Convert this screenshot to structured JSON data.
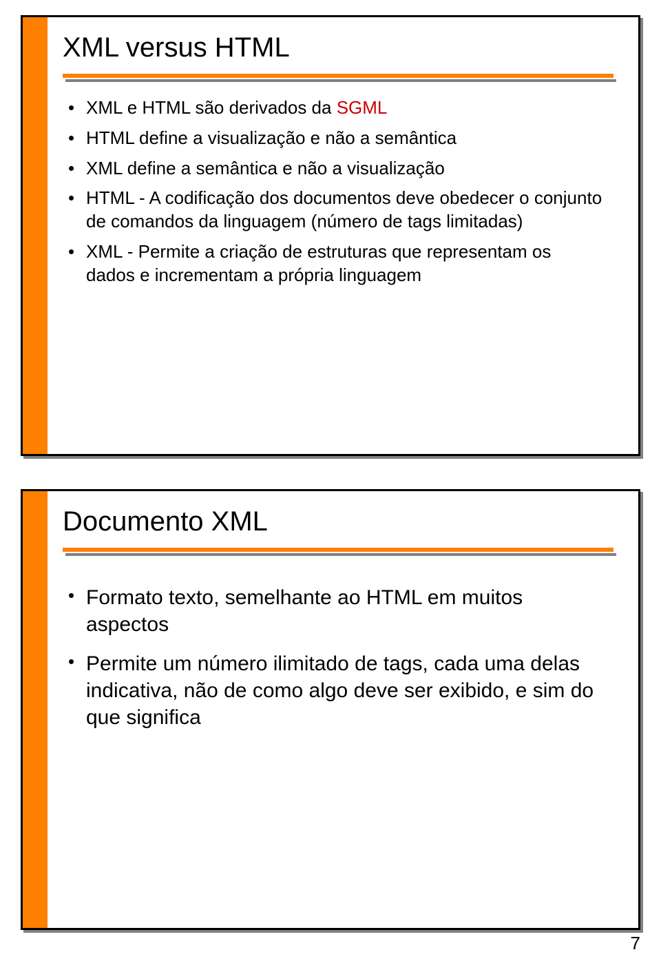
{
  "page_number": "7",
  "slide1": {
    "title": "XML versus HTML",
    "bullets": {
      "b1_pre": "XML e HTML são derivados da ",
      "b1_red": "SGML",
      "b2": "HTML define a visualização e não a semântica",
      "b3": "XML define a semântica e não a visualização",
      "b4": "HTML - A codificação dos documentos deve obedecer o conjunto de comandos da linguagem (número de tags limitadas)",
      "b5": "XML - Permite a criação de estruturas que representam os dados e incrementam a própria linguagem"
    }
  },
  "slide2": {
    "title": "Documento XML",
    "bullets": {
      "b1": "Formato texto, semelhante ao HTML em muitos aspectos",
      "b2": "Permite um número ilimitado de tags, cada uma delas indicativa, não de como algo deve ser exibido, e sim do que significa"
    }
  }
}
